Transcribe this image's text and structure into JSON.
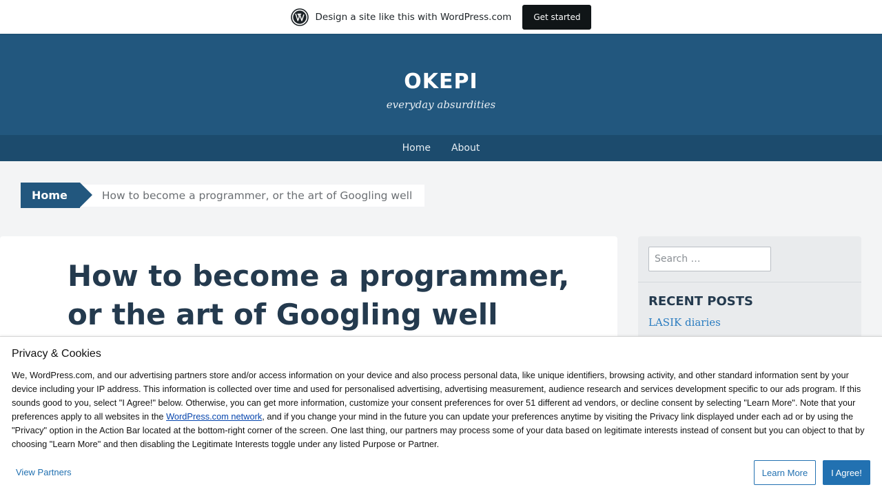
{
  "wpbar": {
    "logo_icon": "wordpress-logo-icon",
    "promo_text": "Design a site like this with WordPress.com",
    "cta_label": "Get started"
  },
  "site": {
    "title": "OKEPI",
    "description": "everyday absurdities"
  },
  "nav": {
    "items": [
      {
        "label": "Home"
      },
      {
        "label": "About"
      }
    ]
  },
  "breadcrumb": {
    "home_label": "Home",
    "current": "How to become a programmer, or the art of Googling well"
  },
  "post": {
    "title": "How to become a programmer, or the art of Googling well"
  },
  "sidebar": {
    "search_placeholder": "Search …",
    "recent_posts_title": "RECENT POSTS",
    "recent_posts": [
      {
        "title": "LASIK diaries"
      }
    ]
  },
  "cookie": {
    "title": "Privacy & Cookies",
    "text_before_link": "We, WordPress.com, and our advertising partners store and/or access information on your device and also process personal data, like unique identifiers, browsing activity, and other standard information sent by your device including your IP address. This information is collected over time and used for personalised advertising, advertising measurement, audience research and services development specific to our ads program. If this sounds good to you, select \"I Agree!\" below. Otherwise, you can get more information, customize your consent preferences for over 51 different ad vendors, or decline consent by selecting \"Learn More\". Note that your preferences apply to all websites in the ",
    "link_text": "WordPress.com network",
    "text_after_link": ", and if you change your mind in the future you can update your preferences anytime by visiting the Privacy link displayed under each ad or by using the \"Privacy\" option in the Action Bar located at the bottom-right corner of the screen. One last thing, our partners may process some of your data based on legitimate interests instead of consent but you can object to that by choosing \"Learn More\" and then disabling the Legitimate Interests toggle under any listed Purpose or Partner.",
    "view_partners_label": "View Partners",
    "learn_more_label": "Learn More",
    "agree_label": "I Agree!"
  },
  "colors": {
    "header_bg": "#22577e",
    "nav_bg": "#1c4b6d",
    "accent_button": "#2271b1",
    "title_text": "#243a4e",
    "link_blue": "#2a7cc0"
  }
}
